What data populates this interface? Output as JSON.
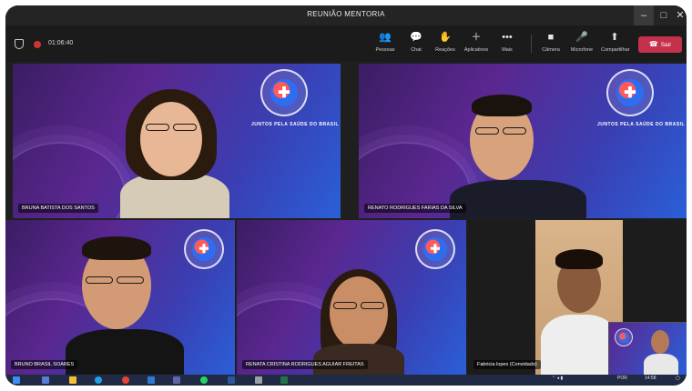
{
  "window": {
    "title": "REUNIÃO MENTORIA"
  },
  "toolbar": {
    "timer": "01:06:40",
    "buttons": [
      {
        "label": "Pessoas",
        "icon": "people-icon"
      },
      {
        "label": "Chat",
        "icon": "chat-icon"
      },
      {
        "label": "Reações",
        "icon": "reactions-icon"
      },
      {
        "label": "Aplicativos",
        "icon": "apps-icon"
      },
      {
        "label": "Mais",
        "icon": "more-icon"
      },
      {
        "label": "Câmera",
        "icon": "camera-icon"
      },
      {
        "label": "Microfone",
        "icon": "microphone-icon"
      },
      {
        "label": "Compartilhar",
        "icon": "share-icon"
      }
    ],
    "leave_label": "Sair"
  },
  "participants": [
    {
      "name": "BRUNA BATISTA DOS SANTOS"
    },
    {
      "name": "RENATO RODRIGUES FARIAS DA SILVA"
    },
    {
      "name": "BRUNO BRASIL SOARES"
    },
    {
      "name": "RENATA CRISTINA RODRIGUES AGUIAR FREITAS"
    },
    {
      "name": "Fabricia lopes (Convidado)"
    }
  ],
  "logo": {
    "text": "JUNTOS PELA SAÚDE DO BRASIL"
  },
  "taskbar": {
    "lang": "POR",
    "time": "14:58"
  },
  "colors": {
    "accent_leave": "#c4314b",
    "tile_bg_start": "#3b1d63",
    "tile_bg_end": "#2a5fd8"
  }
}
